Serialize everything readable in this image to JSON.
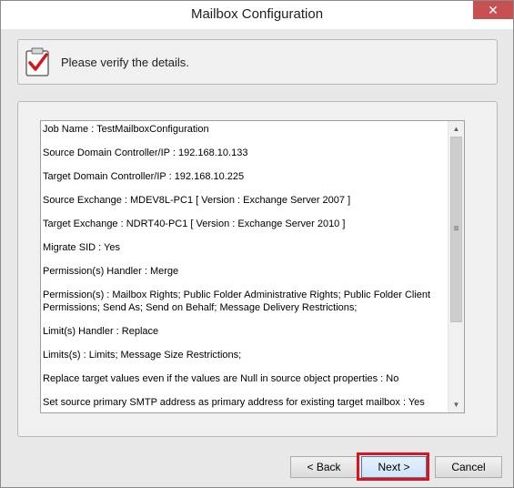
{
  "window": {
    "title": "Mailbox Configuration",
    "close_glyph": "✕"
  },
  "header": {
    "icon": "clipboard-check-icon",
    "text": "Please verify the details."
  },
  "details": [
    "Job Name : TestMailboxConfiguration",
    "Source Domain Controller/IP : 192.168.10.133",
    "Target Domain Controller/IP : 192.168.10.225",
    "Source Exchange : MDEV8L-PC1 [ Version : Exchange Server 2007 ]",
    "Target Exchange : NDRT40-PC1 [ Version : Exchange Server 2010 ]",
    "Migrate SID : Yes",
    "Permission(s) Handler : Merge",
    "Permission(s) : Mailbox Rights; Public Folder Administrative Rights; Public Folder Client Permissions; Send As; Send on Behalf; Message Delivery Restrictions;",
    "Limit(s) Handler : Replace",
    "Limits(s) : Limits; Message Size Restrictions;",
    "Replace target values even if the values are Null in source object properties : No",
    "Set source primary SMTP address as primary address for existing target mailbox : Yes"
  ],
  "scrollbar": {
    "up_glyph": "▲",
    "down_glyph": "▼",
    "grip_glyph": "≡"
  },
  "buttons": {
    "back": "< Back",
    "next": "Next >",
    "cancel": "Cancel"
  },
  "colors": {
    "highlight": "#e0121b",
    "close": "#c75050"
  }
}
